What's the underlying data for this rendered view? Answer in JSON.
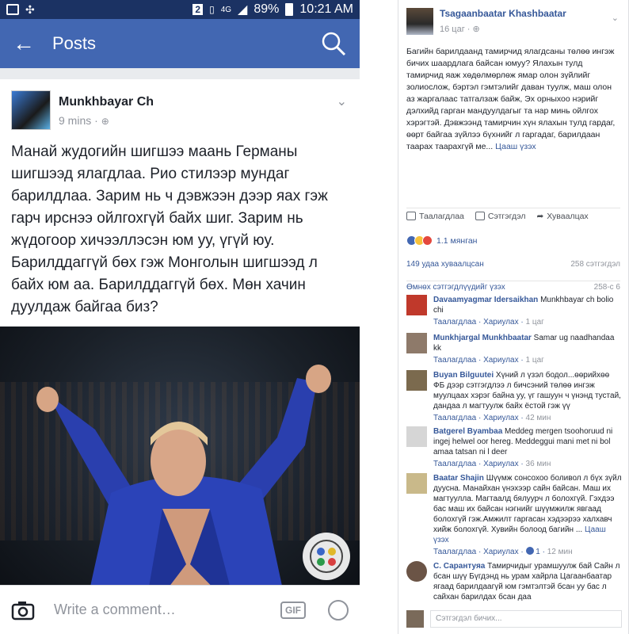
{
  "phone": {
    "status": {
      "battery": "89%",
      "time": "10:21 AM",
      "net": "4G",
      "badge": "2"
    },
    "appbar": {
      "title": "Posts"
    },
    "post": {
      "author": "Munkhbayar Ch",
      "time": "9 mins ·",
      "text": "Манай жудогийн шигшээ маань Германы шигшээд ялагдлаа. Рио стилээр мундаг барилдлаа. Зарим нь ч дэвжээн дээр яах гэж гарч ирснээ ойлгохгүй байх шиг. Зарим нь жүдогоор хичээллэсэн юм уу, үгүй юу. Барилддаггүй бөх гэж Монголын шигшээд л байх юм аа. Барилддаггүй бөх. Мөн хачин дуулдаж байгаа биз?"
    },
    "comment_bar": {
      "placeholder": "Write a comment…",
      "gif": "GIF"
    }
  },
  "desktop": {
    "post": {
      "author": "Tsagaanbaatar Khashbaatar",
      "time": "16 цаг · ",
      "text": "Багийн барилдаанд тамирчид ялагдсаны төлөө ингэж бичих шаардлага байсан юмуу? Ялахын тулд тамирчид яаж хөдөлмөрлөж ямар олон зүйлийг золиослож, бэртэл гэмтэлийг даван туулж, маш олон аз жаргалаас татгалзаж байж, Эх орныхоо нэрийг дэлхийд гарган мандуулдагыг та нар минь ойлгох хэрэгтэй. Дэвжээнд тамирчин хүн ялахын тулд гардаг, өөрт байгаа зүйлээ бүхнийг л гаргадаг, барилдаан таарах таарахгүй ме... ",
      "see_more": "Цааш үзэх"
    },
    "actions": {
      "like": "Таалагдлаа",
      "comment": "Сэтгэгдэл",
      "share": "Хуваалцах"
    },
    "reactions": {
      "count": "1.1 мянган"
    },
    "stats": {
      "shares": "149 удаа хуваалцсан",
      "comments": "258 сэтгэгдэл"
    },
    "previous": {
      "label": "Өмнөх сэтгэгдлүүдийг үзэх",
      "count": "258-с 6"
    },
    "comments": [
      {
        "name": "Davaamyagmar Idersaikhan",
        "text": " Munkhbayar ch bolio chi",
        "like": "Таалагдлаа",
        "reply": "Хариулах",
        "time": "1 цаг"
      },
      {
        "name": "Munkhjargal Munkhbaatar",
        "text": " Samar ug naadhandaa kk",
        "like": "Таалагдлаа",
        "reply": "Хариулах",
        "time": "1 цаг"
      },
      {
        "name": "Buyan Bilguutei",
        "text": " Хүний л үзэл бодол...өөрийхөө ФБ дээр сэтгэгдлээ л бичсэний төлөө ингэж муулцаах хэрэг байна уу, үг гашуун ч үнэнд тустай, дандаа л магтуулж байх ёстой гэж үү",
        "like": "Таалагдлаа",
        "reply": "Хариулах",
        "time": "42 мин"
      },
      {
        "name": "Batgerel Byambaa",
        "text": " Meddeg mergen tsoohoruud ni ingej helwel oor hereg. Meddeggui mani met ni bol amaa tatsan ni l deer",
        "like": "Таалагдлаа",
        "reply": "Хариулах",
        "time": "36 мин"
      },
      {
        "name": "Baatar Shajin",
        "text": " Шүүмж сонсохоо боливол л бүх зүйл дууснa. Манайхан үнэхээр сайн байсан. Маш их магтуулла. Магтаалд бялуурч л болохгүй. Гэхдээ бас маш их байсан нэгнийг шүүмжилж явгаад болохгүй гэж.Амжилт гаргасан хэдээрээ халхавч хийж болохгүй. Хувийн болоод багийн ... ",
        "more": "Цааш үзэх",
        "like": "Таалагдлаа",
        "reply": "Хариулах",
        "likes": "1",
        "time": "12 мин"
      },
      {
        "name": "С. Сарантуяа",
        "text": " Тамирчидыг урамшуулж бай Сайн л бсан шүү Бүгдэнд нь урам хайрла Цагаанбаатар ягаад барилдаагүй юм гэмтэлтэй бсан уу бас л сайхан барилдах бсан даа"
      }
    ],
    "input": {
      "placeholder": "Сэтгэгдэл бичих..."
    }
  }
}
